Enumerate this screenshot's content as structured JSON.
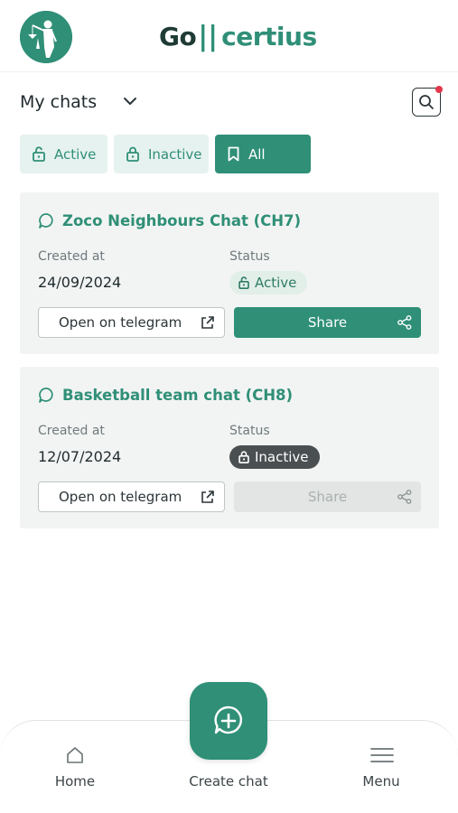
{
  "header": {
    "logo": {
      "go": "Go",
      "certius": "certius"
    }
  },
  "chats_header": {
    "title": "My chats"
  },
  "filters": [
    {
      "label": "Active",
      "icon": "lock-open-icon",
      "selected": false
    },
    {
      "label": "Inactive",
      "icon": "lock-icon",
      "selected": false
    },
    {
      "label": "All",
      "icon": "bookmark-icon",
      "selected": true
    }
  ],
  "chats": [
    {
      "title": "Zoco Neighbours Chat (CH7)",
      "created_label": "Created at",
      "created_value": "24/09/2024",
      "status_label": "Status",
      "status_value": "Active",
      "open_label": "Open on telegram",
      "share_label": "Share",
      "share_enabled": true
    },
    {
      "title": "Basketball team chat (CH8)",
      "created_label": "Created at",
      "created_value": "12/07/2024",
      "status_label": "Status",
      "status_value": "Inactive",
      "open_label": "Open on telegram",
      "share_label": "Share",
      "share_enabled": false
    }
  ],
  "bottom_nav": {
    "home": "Home",
    "create": "Create chat",
    "menu": "Menu"
  },
  "colors": {
    "primary": "#2f8f77",
    "primary_light": "#e6f2ef",
    "card_bg": "#f2f4f3",
    "notification": "#e2374c",
    "inactive_badge": "#4a4f51"
  }
}
